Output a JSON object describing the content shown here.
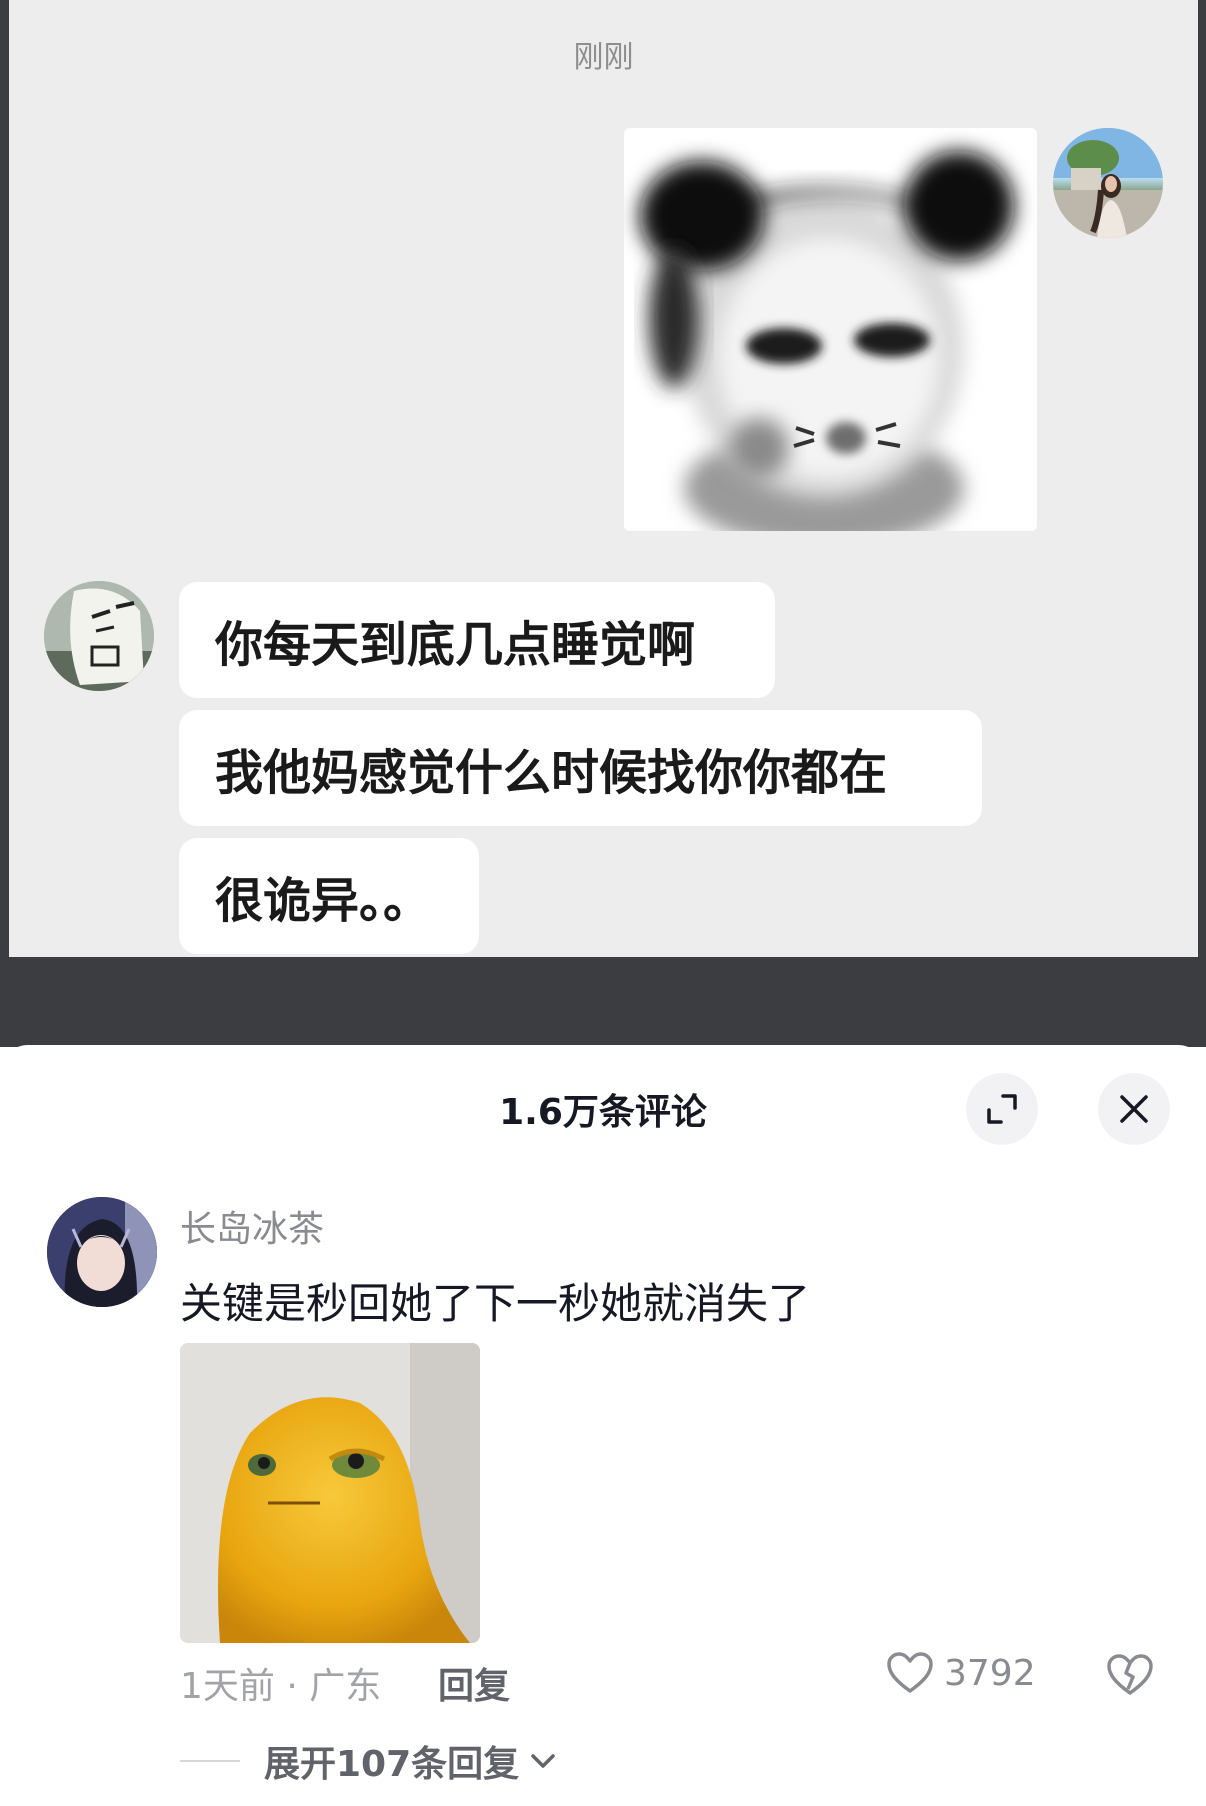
{
  "chat": {
    "timestamp": "刚刚",
    "messages": [
      "你每天到底几点睡觉啊",
      "我他妈感觉什么时候找你你都在",
      "很诡异。。"
    ]
  },
  "comments_sheet": {
    "title": "1.6万条评论",
    "expand_icon": "expand-icon",
    "close_icon": "close-icon"
  },
  "comment": {
    "username": "长岛冰茶",
    "text": "关键是秒回她了下一秒她就消失了",
    "meta": "1天前 · 广东",
    "reply_label": "回复",
    "likes": "3792",
    "like_icon": "heart-icon",
    "dislike_icon": "broken-heart-icon",
    "expand_replies": "展开107条回复"
  }
}
